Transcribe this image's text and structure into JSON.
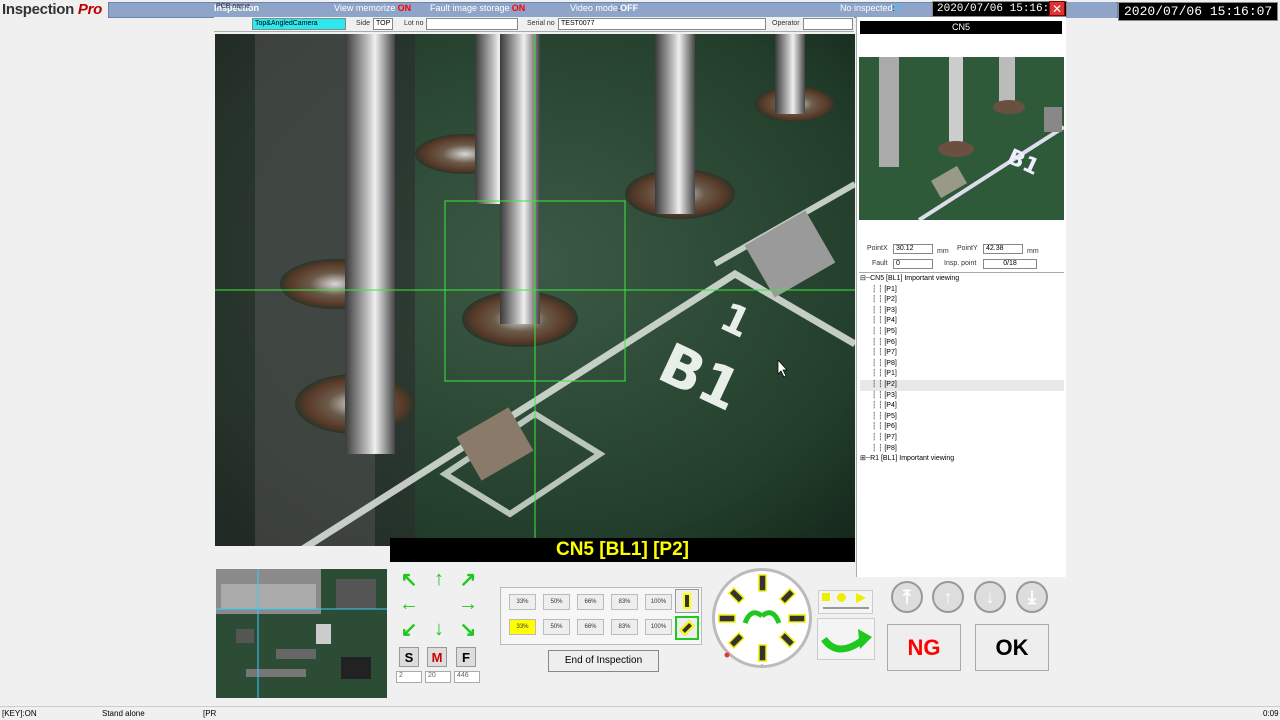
{
  "app": {
    "logo_text": "Inspection",
    "logo_pro": "Pro",
    "title": "Inspection"
  },
  "header": {
    "view_memorize_label": "View memorize",
    "view_memorize_value": "ON",
    "fault_storage_label": "Fault image storage",
    "fault_storage_value": "ON",
    "video_mode_label": "Video mode",
    "video_mode_value": "OFF",
    "no_inspected_label": "No inspected",
    "no_inspected_value": "5",
    "datetime": "2020/07/06 15:16:07",
    "datetime_outer": "2020/07/06 15:16:07",
    "close_label": "✕"
  },
  "info": {
    "pcb_label": "PCB name",
    "pcb_value": "Top&AngledCamera",
    "side_label": "Side",
    "side_value": "TOP",
    "lot_label": "Lot no",
    "lot_value": "",
    "serial_label": "Serial no",
    "serial_value": "TEST0077",
    "operator_label": "Operator",
    "operator_value": ""
  },
  "camera": {
    "silkscreen_text": "B1",
    "silkscreen_text2": "1"
  },
  "right": {
    "thumb_title": "CN5",
    "pointx_label": "PointX",
    "pointx_value": "30.12",
    "pointx_unit": "mm",
    "pointy_label": "PointY",
    "pointy_value": "42.38",
    "pointy_unit": "mm",
    "fault_label": "Fault",
    "fault_value": "0",
    "insp_label": "Insp. point",
    "insp_value": "0/18"
  },
  "tree": {
    "root1": "CN5  [BL1]   Important viewing",
    "items": [
      "[P1]",
      "[P2]",
      "[P3]",
      "[P4]",
      "[P5]",
      "[P6]",
      "[P7]",
      "[P8]",
      "[P1]",
      "[P2]",
      "[P3]",
      "[P4]",
      "[P5]",
      "[P6]",
      "[P7]",
      "[P8]"
    ],
    "root2": "R1  [BL1]   Important viewing",
    "selected_index": 9
  },
  "main": {
    "current_point": "CN5 [BL1] [P2]"
  },
  "controls": {
    "s_label": "S",
    "m_label": "M",
    "f_label": "F",
    "spin1": "2",
    "spin2": "20",
    "spin3": "446",
    "pct_row1": [
      "33%",
      "50%",
      "66%",
      "83%",
      "100%"
    ],
    "pct_row2": [
      "33%",
      "50%",
      "66%",
      "83%",
      "100%"
    ],
    "end_label": "End of Inspection",
    "ng_label": "NG",
    "ok_label": "OK"
  },
  "status": {
    "key": "[KEY]:ON",
    "mode": "Stand alone",
    "pr": "[PR",
    "right": "0:09"
  },
  "colors": {
    "ng": "#ff0000",
    "ok": "#000000",
    "title_yellow": "#ffff00",
    "accent_green": "#1ec81e"
  }
}
